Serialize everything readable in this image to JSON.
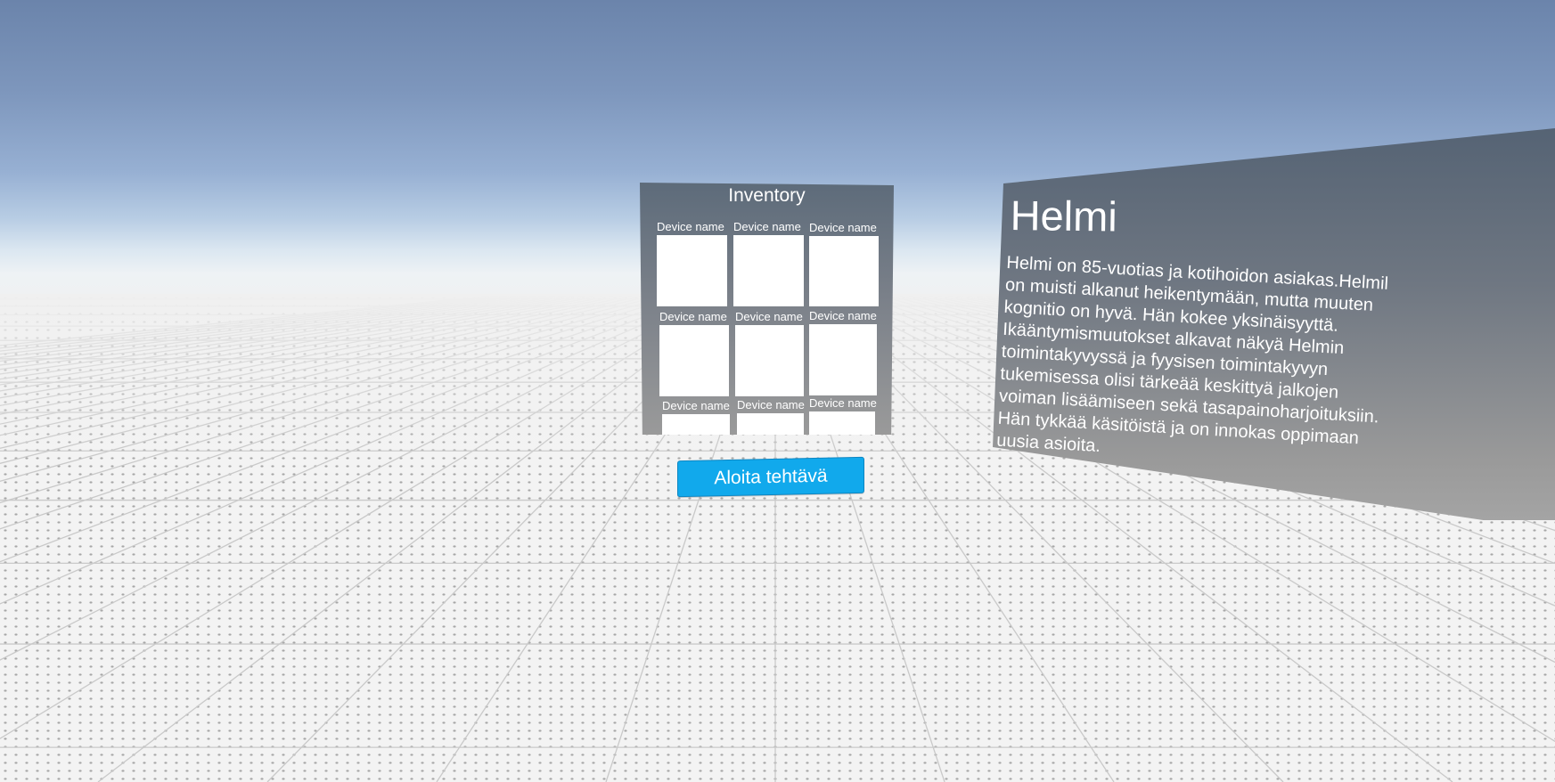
{
  "inventory": {
    "title": "Inventory",
    "slots": [
      {
        "label": "Device name"
      },
      {
        "label": "Device name"
      },
      {
        "label": "Device name"
      },
      {
        "label": "Device name"
      },
      {
        "label": "Device name"
      },
      {
        "label": "Device name"
      },
      {
        "label": "Device name"
      },
      {
        "label": "Device name"
      },
      {
        "label": "Device name"
      }
    ]
  },
  "start_button": {
    "label": "Aloita tehtävä",
    "color": "#11a9ec"
  },
  "character": {
    "name": "Helmi",
    "description_lines": [
      "Helmi on 85-vuotias ja kotihoidon asiakas.Helmil",
      "on muisti alkanut heikentymään, mutta muuten",
      "kognitio on hyvä. Hän kokee yksinäisyyttä.",
      "Ikääntymismuutokset alkavat näkyä Helmin",
      "toimintakyvyssä ja fyysisen toimintakyvyn",
      "tukemisessa olisi tärkeää keskittyä jalkojen",
      "voiman lisäämiseen sekä tasapainoharjoituksiin.",
      "Hän tykkää käsitöistä ja on innokas oppimaan",
      "uusia asioita."
    ]
  },
  "colors": {
    "sky_top": "#6b84ab",
    "floor": "#f2f2f2",
    "panel": "#6f7782"
  }
}
